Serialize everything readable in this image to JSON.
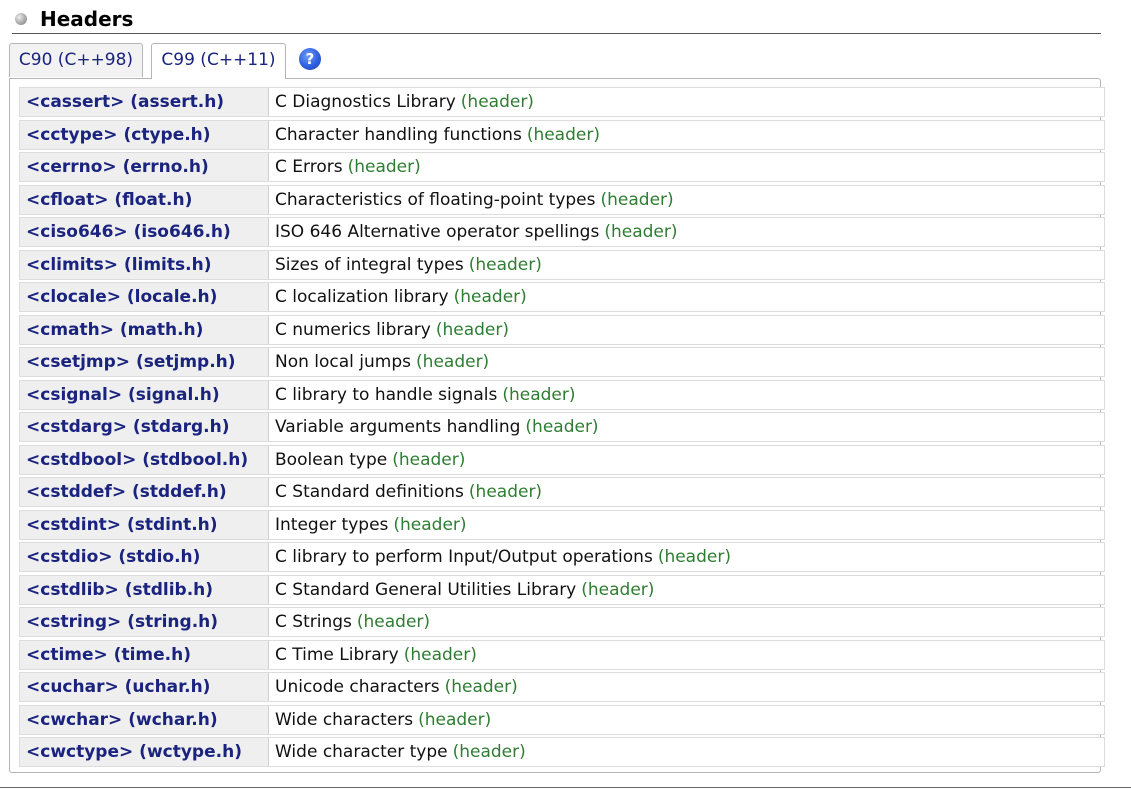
{
  "section": {
    "title": "Headers"
  },
  "tabs": [
    {
      "label": "C90 (C++98)",
      "active": false
    },
    {
      "label": "C99 (C++11)",
      "active": true
    }
  ],
  "help_icon": {
    "glyph": "?",
    "icon": "help-icon"
  },
  "colors": {
    "link": "#1a237e",
    "kind": "#2e7d32",
    "name_cell_bg": "#efefef"
  },
  "headers": [
    {
      "name": "<cassert> (assert.h)",
      "description": "C Diagnostics Library",
      "kind": "(header)"
    },
    {
      "name": "<cctype> (ctype.h)",
      "description": "Character handling functions",
      "kind": "(header)"
    },
    {
      "name": "<cerrno> (errno.h)",
      "description": "C Errors",
      "kind": "(header)"
    },
    {
      "name": "<cfloat> (float.h)",
      "description": "Characteristics of floating-point types",
      "kind": "(header)"
    },
    {
      "name": "<ciso646> (iso646.h)",
      "description": "ISO 646 Alternative operator spellings",
      "kind": "(header)"
    },
    {
      "name": "<climits> (limits.h)",
      "description": "Sizes of integral types",
      "kind": "(header)"
    },
    {
      "name": "<clocale> (locale.h)",
      "description": "C localization library",
      "kind": "(header)"
    },
    {
      "name": "<cmath> (math.h)",
      "description": "C numerics library",
      "kind": "(header)"
    },
    {
      "name": "<csetjmp> (setjmp.h)",
      "description": "Non local jumps",
      "kind": "(header)"
    },
    {
      "name": "<csignal> (signal.h)",
      "description": "C library to handle signals",
      "kind": "(header)"
    },
    {
      "name": "<cstdarg> (stdarg.h)",
      "description": "Variable arguments handling",
      "kind": "(header)"
    },
    {
      "name": "<cstdbool> (stdbool.h)",
      "description": "Boolean type",
      "kind": "(header)"
    },
    {
      "name": "<cstddef> (stddef.h)",
      "description": "C Standard definitions",
      "kind": "(header)"
    },
    {
      "name": "<cstdint> (stdint.h)",
      "description": "Integer types",
      "kind": "(header)"
    },
    {
      "name": "<cstdio> (stdio.h)",
      "description": "C library to perform Input/Output operations",
      "kind": "(header)"
    },
    {
      "name": "<cstdlib> (stdlib.h)",
      "description": "C Standard General Utilities Library",
      "kind": "(header)"
    },
    {
      "name": "<cstring> (string.h)",
      "description": "C Strings",
      "kind": "(header)"
    },
    {
      "name": "<ctime> (time.h)",
      "description": "C Time Library",
      "kind": "(header)"
    },
    {
      "name": "<cuchar> (uchar.h)",
      "description": "Unicode characters",
      "kind": "(header)"
    },
    {
      "name": "<cwchar> (wchar.h)",
      "description": "Wide characters",
      "kind": "(header)"
    },
    {
      "name": "<cwctype> (wctype.h)",
      "description": "Wide character type",
      "kind": "(header)"
    }
  ]
}
